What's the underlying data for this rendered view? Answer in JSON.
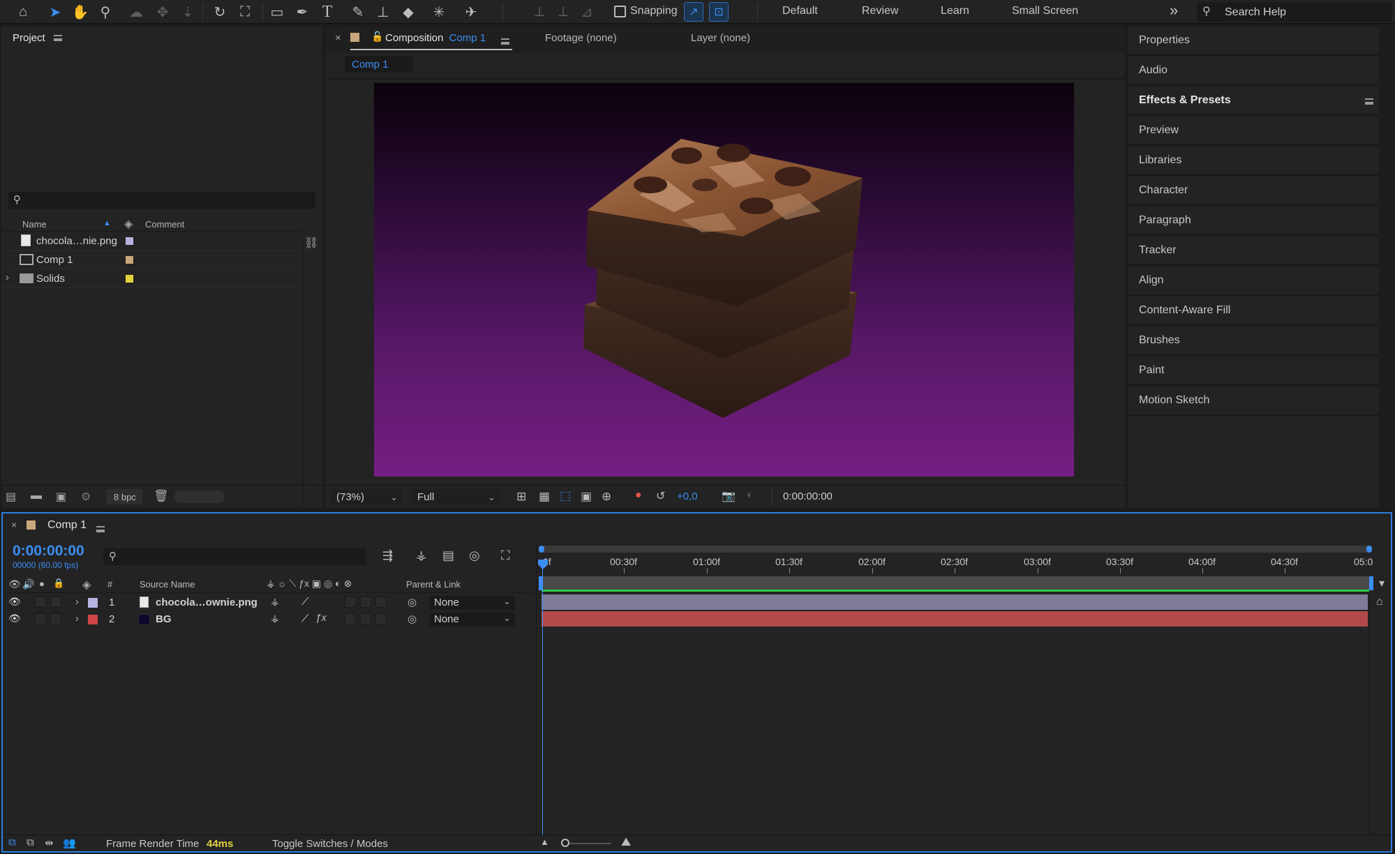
{
  "toolbar": {
    "icons": [
      "home-icon",
      "selection-arrow-icon",
      "hand-icon",
      "zoom-icon",
      "orbit-icon",
      "pan-icon",
      "dolly-icon",
      "rotation-icon",
      "pan-behind-icon",
      "rectangle-icon",
      "pen-icon",
      "type-icon",
      "brush-icon",
      "clone-stamp-icon",
      "eraser-icon",
      "roto-brush-icon",
      "puppet-pin-icon"
    ],
    "snapping_label": "Snapping",
    "workspaces": [
      "Default",
      "Review",
      "Learn",
      "Small Screen"
    ],
    "overflow_glyph": "»",
    "search_placeholder": "Search Help"
  },
  "project": {
    "title": "Project",
    "search_placeholder": "",
    "columns": {
      "name": "Name",
      "comment": "Comment"
    },
    "items": [
      {
        "name": "chocola…nie.png",
        "type": "file",
        "color": "#b6b3e0"
      },
      {
        "name": "Comp 1",
        "type": "composition",
        "color": "#c9a77c"
      },
      {
        "name": "Solids",
        "type": "folder",
        "color": "#e4d33e"
      }
    ],
    "bpc": "8 bpc"
  },
  "composition": {
    "close_glyph": "×",
    "tab_prefix": "Composition",
    "tab_name": "Comp 1",
    "footage_tab": "Footage (none)",
    "layer_tab": "Layer (none)",
    "sub_tab": "Comp 1",
    "zoom": "(73%)",
    "resolution": "Full",
    "exposure": "+0,0",
    "timecode": "0:00:00:00",
    "bg_color_top": "#0a020a",
    "bg_color_bottom": "#751f82"
  },
  "right_panels": [
    "Properties",
    "Audio",
    "Effects & Presets",
    "Preview",
    "Libraries",
    "Character",
    "Paragraph",
    "Tracker",
    "Align",
    "Content-Aware Fill",
    "Brushes",
    "Paint",
    "Motion Sketch"
  ],
  "timeline": {
    "comp_name": "Comp 1",
    "timecode": "0:00:00:00",
    "frame_info": "00000 (60.00 fps)",
    "columns": {
      "num": "#",
      "source": "Source Name",
      "parent": "Parent & Link"
    },
    "layers": [
      {
        "num": "1",
        "name": "chocola…ownie.png",
        "label_color": "#b6b3e0",
        "parent": "None",
        "bar_color": "#7d7b97"
      },
      {
        "num": "2",
        "name": "BG",
        "label_color": "#d04545",
        "parent": "None",
        "bar_color": "#b24a4c"
      }
    ],
    "ruler": [
      "0f",
      "00:30f",
      "01:00f",
      "01:30f",
      "02:00f",
      "02:30f",
      "03:00f",
      "03:30f",
      "04:00f",
      "04:30f",
      "05:0"
    ],
    "render_time_label": "Frame Render Time",
    "render_time_value": "44ms",
    "toggle_label": "Toggle Switches / Modes"
  }
}
